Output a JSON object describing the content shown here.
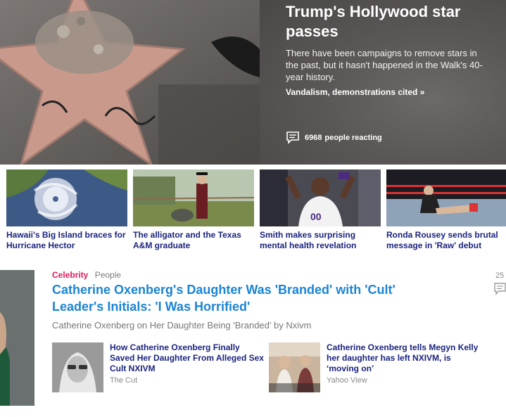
{
  "hero": {
    "title": "Trump's Hollywood star passes",
    "summary": "There have been campaigns to remove stars in the past, but it hasn't happened in the Walk's 40-year history.",
    "link": "Vandalism, demonstrations cited »",
    "reacting_count": "6968",
    "reacting_label": "people reacting"
  },
  "thumbnails": [
    {
      "caption": "Hawaii's Big Island braces for Hurricane Hector"
    },
    {
      "caption": "The alligator and the Texas A&M graduate"
    },
    {
      "caption": "Smith makes surprising mental health revelation"
    },
    {
      "caption": "Ronda Rousey sends brutal message in 'Raw' debut"
    }
  ],
  "story": {
    "category": "Celebrity",
    "subcategory": "People",
    "title": "Catherine Oxenberg's Daughter Was 'Branded' with 'Cult' Leader's Initials: 'I Was Horrified'",
    "subtitle": "Catherine Oxenberg on Her Daughter Being 'Branded' by Nxivm",
    "related": [
      {
        "title": "How Catherine Oxenberg Finally Saved Her Daughter From Alleged Sex Cult NXIVM",
        "source": "The Cut"
      },
      {
        "title": "Catherine Oxenberg tells Megyn Kelly her daughter has left NXIVM, is ‘moving on’",
        "source": "Yahoo View"
      }
    ],
    "comment_count": "25"
  },
  "colors": {
    "category": "#e0195c",
    "story_title": "#1b84d4",
    "headline_navy": "#1a237e"
  }
}
